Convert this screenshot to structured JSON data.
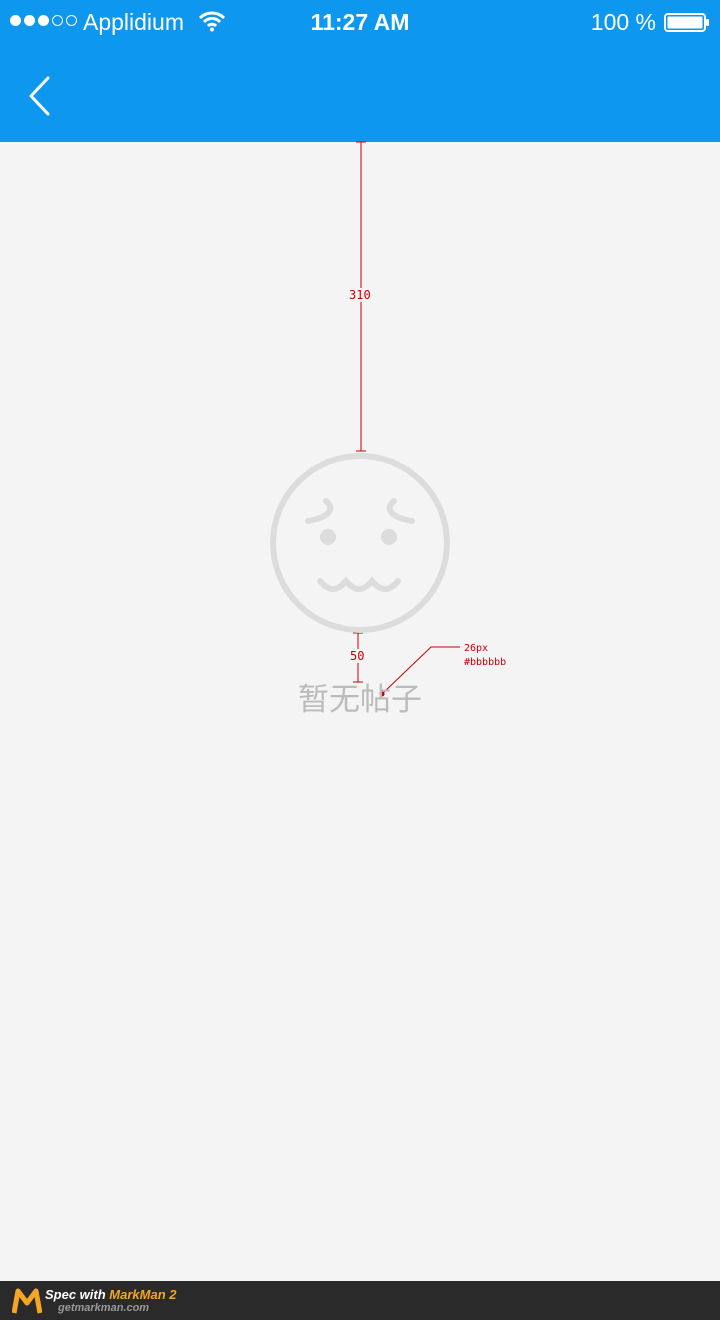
{
  "status_bar": {
    "carrier": "Applidium",
    "time": "11:27 AM",
    "battery_text": "100 %",
    "signal_dots": [
      "full",
      "full",
      "full",
      "empty",
      "empty"
    ]
  },
  "nav_bar": {
    "back_icon": "chevron-left-icon"
  },
  "empty_state": {
    "icon": "sad-face-icon",
    "message": "暂无帖子"
  },
  "annotations": {
    "top_distance": "310",
    "gap_distance": "50",
    "font_size_note": "26px",
    "color_note": "#bbbbbb"
  },
  "footer": {
    "spec_prefix": "Spec with ",
    "brand": "MarkMan 2",
    "site": "getmarkman.com"
  },
  "colors": {
    "primary": "#0e97ee",
    "background": "#f4f4f4",
    "empty_text": "#bbbbbb",
    "spec_red": "#cc0000"
  }
}
